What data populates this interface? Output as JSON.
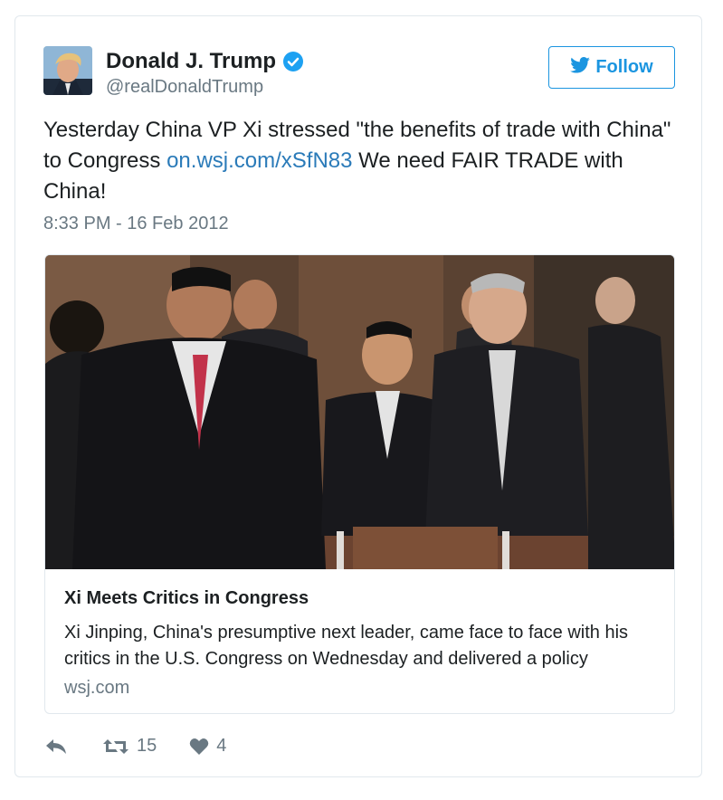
{
  "tweet": {
    "author": {
      "name": "Donald J. Trump",
      "handle": "@realDonaldTrump",
      "avatar_icon": "avatar-photo",
      "verified_icon": "verified-badge-icon"
    },
    "follow_label": "Follow",
    "text_before_link": "Yesterday China VP Xi stressed \"the benefits of trade with China\" to Congress ",
    "link_text": "on.wsj.com/xSfN83",
    "text_after_link": " We need FAIR TRADE with China!",
    "timestamp": "8:33 PM - 16 Feb 2012"
  },
  "card": {
    "image_icon": "news-photo",
    "title": "Xi Meets Critics in Congress",
    "description": "Xi Jinping, China's presumptive next leader, came face to face with his critics in the U.S. Congress on Wednesday and delivered a policy",
    "domain": "wsj.com"
  },
  "actions": {
    "reply_icon": "reply-icon",
    "retweet_icon": "retweet-icon",
    "retweet_count": "15",
    "like_icon": "heart-icon",
    "like_count": "4"
  },
  "colors": {
    "link": "#2b7bb9",
    "follow": "#1b95e0",
    "muted": "#697882",
    "border": "#e1e8ed"
  }
}
